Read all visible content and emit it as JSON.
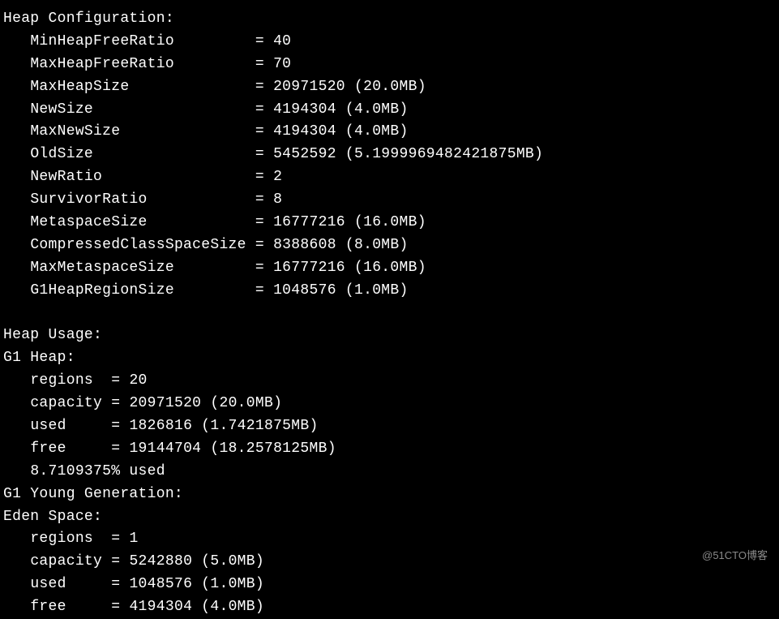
{
  "heap_config": {
    "title": "Heap Configuration:",
    "MinHeapFreeRatio": {
      "label": "MinHeapFreeRatio",
      "value": "40"
    },
    "MaxHeapFreeRatio": {
      "label": "MaxHeapFreeRatio",
      "value": "70"
    },
    "MaxHeapSize": {
      "label": "MaxHeapSize",
      "value": "20971520 (20.0MB)"
    },
    "NewSize": {
      "label": "NewSize",
      "value": "4194304 (4.0MB)"
    },
    "MaxNewSize": {
      "label": "MaxNewSize",
      "value": "4194304 (4.0MB)"
    },
    "OldSize": {
      "label": "OldSize",
      "value": "5452592 (5.1999969482421875MB)"
    },
    "NewRatio": {
      "label": "NewRatio",
      "value": "2"
    },
    "SurvivorRatio": {
      "label": "SurvivorRatio",
      "value": "8"
    },
    "MetaspaceSize": {
      "label": "MetaspaceSize",
      "value": "16777216 (16.0MB)"
    },
    "CompressedClassSpaceSize": {
      "label": "CompressedClassSpaceSize",
      "value": "8388608 (8.0MB)"
    },
    "MaxMetaspaceSize": {
      "label": "MaxMetaspaceSize",
      "value": "16777216 (16.0MB)"
    },
    "G1HeapRegionSize": {
      "label": "G1HeapRegionSize",
      "value": "1048576 (1.0MB)"
    }
  },
  "heap_usage": {
    "title": "Heap Usage:",
    "g1heap": {
      "title": "G1 Heap:",
      "regions": {
        "label": "regions",
        "value": "20"
      },
      "capacity": {
        "label": "capacity",
        "value": "20971520 (20.0MB)"
      },
      "used": {
        "label": "used",
        "value": "1826816 (1.7421875MB)"
      },
      "free": {
        "label": "free",
        "value": "19144704 (18.2578125MB)"
      },
      "pct_used": "8.7109375% used"
    },
    "young_gen": {
      "title": "G1 Young Generation:"
    },
    "eden": {
      "title": "Eden Space:",
      "regions": {
        "label": "regions",
        "value": "1"
      },
      "capacity": {
        "label": "capacity",
        "value": "5242880 (5.0MB)"
      },
      "used": {
        "label": "used",
        "value": "1048576 (1.0MB)"
      },
      "free": {
        "label": "free",
        "value": "4194304 (4.0MB)"
      }
    }
  },
  "watermark": "@51CTO博客"
}
